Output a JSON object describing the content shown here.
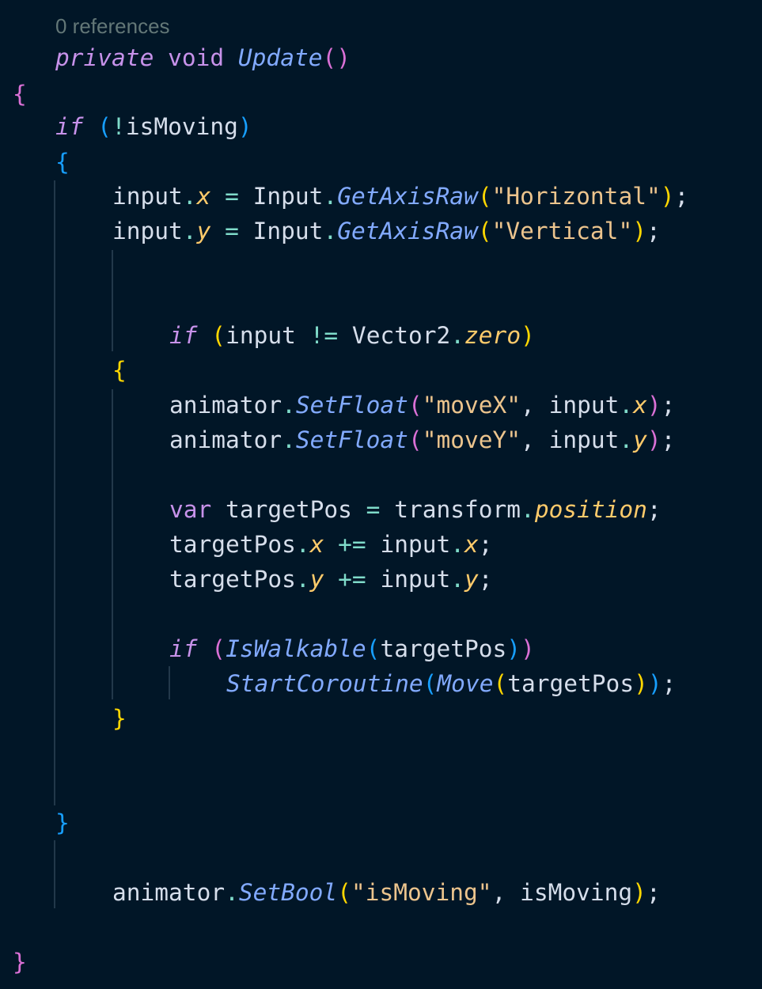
{
  "editor": {
    "codelens": "0 references",
    "lines": [
      [
        [
          "kw",
          "private"
        ],
        [
          "txt",
          " "
        ],
        [
          "kw-plain",
          "void"
        ],
        [
          "txt",
          " "
        ],
        [
          "fn",
          "Update"
        ],
        [
          "b2",
          "()"
        ]
      ],
      [
        [
          "b2",
          "{"
        ]
      ],
      [
        [
          "kw",
          "if"
        ],
        [
          "txt",
          " "
        ],
        [
          "b3",
          "("
        ],
        [
          "punc",
          "!"
        ],
        [
          "txt",
          "isMoving"
        ],
        [
          "b3",
          ")"
        ]
      ],
      [
        [
          "b3",
          "{"
        ]
      ],
      [
        [
          "txt",
          "input"
        ],
        [
          "punc",
          "."
        ],
        [
          "prop",
          "x"
        ],
        [
          "txt",
          " "
        ],
        [
          "punc",
          "="
        ],
        [
          "txt",
          " Input"
        ],
        [
          "punc",
          "."
        ],
        [
          "fn",
          "GetAxisRaw"
        ],
        [
          "b1",
          "("
        ],
        [
          "str",
          "\"Horizontal\""
        ],
        [
          "b1",
          ")"
        ],
        [
          "txt",
          ";"
        ]
      ],
      [
        [
          "txt",
          "input"
        ],
        [
          "punc",
          "."
        ],
        [
          "prop",
          "y"
        ],
        [
          "txt",
          " "
        ],
        [
          "punc",
          "="
        ],
        [
          "txt",
          " Input"
        ],
        [
          "punc",
          "."
        ],
        [
          "fn",
          "GetAxisRaw"
        ],
        [
          "b1",
          "("
        ],
        [
          "str",
          "\"Vertical\""
        ],
        [
          "b1",
          ")"
        ],
        [
          "txt",
          ";"
        ]
      ],
      [
        [
          "kw",
          "if"
        ],
        [
          "txt",
          " "
        ],
        [
          "b1",
          "("
        ],
        [
          "txt",
          "input "
        ],
        [
          "punc",
          "!="
        ],
        [
          "txt",
          " Vector2"
        ],
        [
          "punc",
          "."
        ],
        [
          "prop",
          "zero"
        ],
        [
          "b1",
          ")"
        ]
      ],
      [
        [
          "b1",
          "{"
        ]
      ],
      [
        [
          "txt",
          "animator"
        ],
        [
          "punc",
          "."
        ],
        [
          "fn",
          "SetFloat"
        ],
        [
          "b2",
          "("
        ],
        [
          "str",
          "\"moveX\""
        ],
        [
          "txt",
          ", input"
        ],
        [
          "punc",
          "."
        ],
        [
          "prop",
          "x"
        ],
        [
          "b2",
          ")"
        ],
        [
          "txt",
          ";"
        ]
      ],
      [
        [
          "txt",
          "animator"
        ],
        [
          "punc",
          "."
        ],
        [
          "fn",
          "SetFloat"
        ],
        [
          "b2",
          "("
        ],
        [
          "str",
          "\"moveY\""
        ],
        [
          "txt",
          ", input"
        ],
        [
          "punc",
          "."
        ],
        [
          "prop",
          "y"
        ],
        [
          "b2",
          ")"
        ],
        [
          "txt",
          ";"
        ]
      ],
      [
        [
          "kw-plain",
          "var"
        ],
        [
          "txt",
          " targetPos "
        ],
        [
          "punc",
          "="
        ],
        [
          "txt",
          " transform"
        ],
        [
          "punc",
          "."
        ],
        [
          "prop",
          "position"
        ],
        [
          "txt",
          ";"
        ]
      ],
      [
        [
          "txt",
          "targetPos"
        ],
        [
          "punc",
          "."
        ],
        [
          "prop",
          "x"
        ],
        [
          "txt",
          " "
        ],
        [
          "punc",
          "+="
        ],
        [
          "txt",
          " input"
        ],
        [
          "punc",
          "."
        ],
        [
          "prop",
          "x"
        ],
        [
          "txt",
          ";"
        ]
      ],
      [
        [
          "txt",
          "targetPos"
        ],
        [
          "punc",
          "."
        ],
        [
          "prop",
          "y"
        ],
        [
          "txt",
          " "
        ],
        [
          "punc",
          "+="
        ],
        [
          "txt",
          " input"
        ],
        [
          "punc",
          "."
        ],
        [
          "prop",
          "y"
        ],
        [
          "txt",
          ";"
        ]
      ],
      [
        [
          "kw",
          "if"
        ],
        [
          "txt",
          " "
        ],
        [
          "b2",
          "("
        ],
        [
          "fn",
          "IsWalkable"
        ],
        [
          "b3",
          "("
        ],
        [
          "txt",
          "targetPos"
        ],
        [
          "b3",
          ")"
        ],
        [
          "b2",
          ")"
        ]
      ],
      [
        [
          "fn",
          "StartCoroutine"
        ],
        [
          "b3",
          "("
        ],
        [
          "fn",
          "Move"
        ],
        [
          "b1",
          "("
        ],
        [
          "txt",
          "targetPos"
        ],
        [
          "b1",
          ")"
        ],
        [
          "b3",
          ")"
        ],
        [
          "txt",
          ";"
        ]
      ],
      [
        [
          "b1",
          "}"
        ]
      ],
      [
        [
          "b3",
          "}"
        ]
      ],
      [
        [
          "txt",
          "animator"
        ],
        [
          "punc",
          "."
        ],
        [
          "fn",
          "SetBool"
        ],
        [
          "b1",
          "("
        ],
        [
          "str",
          "\"isMoving\""
        ],
        [
          "txt",
          ", isMoving"
        ],
        [
          "b1",
          ")"
        ],
        [
          "txt",
          ";"
        ]
      ],
      [
        [
          "b2",
          "}"
        ]
      ]
    ]
  },
  "theme": {
    "background": "#011627",
    "keyword": "#c792ea",
    "function": "#82aaff",
    "property": "#ffcb6b",
    "string": "#ecc48d",
    "text": "#d6deeb",
    "codelens": "#637777",
    "bracket_level1": "#ffd700",
    "bracket_level2": "#da70d6",
    "bracket_level3": "#179fff"
  }
}
